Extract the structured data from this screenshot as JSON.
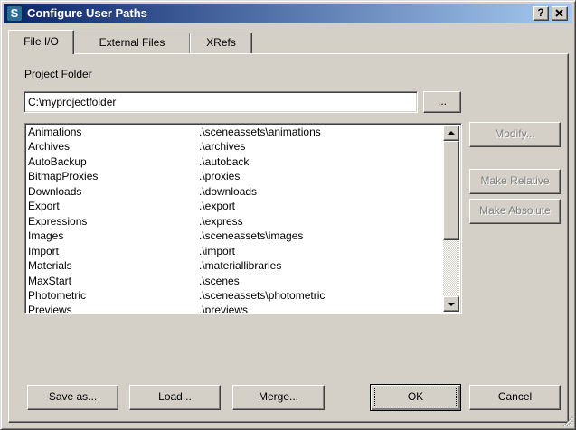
{
  "window": {
    "title": "Configure User Paths",
    "help_label": "?",
    "close_label": "X"
  },
  "tabs": [
    {
      "label": "File I/O"
    },
    {
      "label": "External Files"
    },
    {
      "label": "XRefs"
    }
  ],
  "project_folder": {
    "label": "Project Folder",
    "path": "C:\\myprojectfolder",
    "browse_label": "..."
  },
  "paths": [
    {
      "name": "Animations",
      "path": ".\\sceneassets\\animations"
    },
    {
      "name": "Archives",
      "path": ".\\archives"
    },
    {
      "name": "AutoBackup",
      "path": ".\\autoback"
    },
    {
      "name": "BitmapProxies",
      "path": ".\\proxies"
    },
    {
      "name": "Downloads",
      "path": ".\\downloads"
    },
    {
      "name": "Export",
      "path": ".\\export"
    },
    {
      "name": "Expressions",
      "path": ".\\express"
    },
    {
      "name": "Images",
      "path": ".\\sceneassets\\images"
    },
    {
      "name": "Import",
      "path": ".\\import"
    },
    {
      "name": "Materials",
      "path": ".\\materiallibraries"
    },
    {
      "name": "MaxStart",
      "path": ".\\scenes"
    },
    {
      "name": "Photometric",
      "path": ".\\sceneassets\\photometric"
    },
    {
      "name": "Previews",
      "path": ".\\previews"
    }
  ],
  "side_buttons": {
    "modify": "Modify...",
    "make_relative": "Make Relative",
    "make_absolute": "Make Absolute"
  },
  "footer": {
    "save_as": "Save as...",
    "load": "Load...",
    "merge": "Merge...",
    "ok": "OK",
    "cancel": "Cancel"
  },
  "colors": {
    "face": "#d4d0c8",
    "title_start": "#0a246a",
    "title_end": "#a6caf0",
    "disabled_text": "#808080"
  }
}
